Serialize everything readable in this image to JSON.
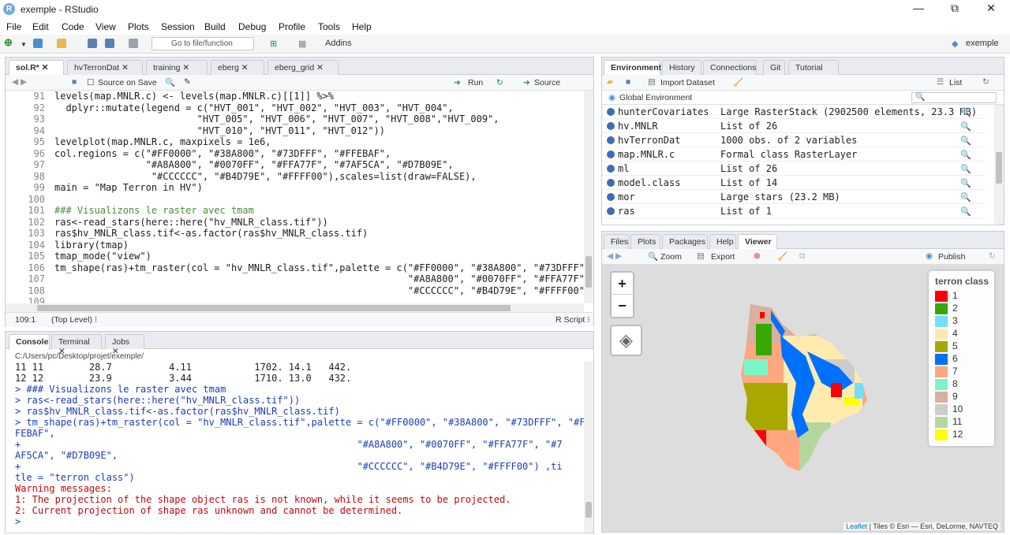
{
  "window": {
    "title": "exemple - RStudio",
    "logo": "R",
    "minimize": "—",
    "restore": "⧉",
    "close": "✕"
  },
  "menu": [
    "File",
    "Edit",
    "Code",
    "View",
    "Plots",
    "Session",
    "Build",
    "Debug",
    "Profile",
    "Tools",
    "Help"
  ],
  "toolbar": {
    "goto_placeholder": "Go to file/function",
    "addins": "Addins",
    "project": "exemple"
  },
  "editor": {
    "tabs": [
      "sol.R*",
      "hvTerronDat",
      "training",
      "eberg",
      "eberg_grid"
    ],
    "source_on_save": "Source on Save",
    "run": "Run",
    "source": "Source",
    "lines": [
      {
        "n": "91",
        "t": "levels(map.MNLR.c) <- levels(map.MNLR.c)[[1]] %>%"
      },
      {
        "n": "92",
        "t": "  dplyr::mutate(legend = c(\"HVT_001\", \"HVT_002\", \"HVT_003\", \"HVT_004\","
      },
      {
        "n": "93",
        "t": "                         \"HVT_005\", \"HVT_006\", \"HVT_007\", \"HVT_008\",\"HVT_009\","
      },
      {
        "n": "94",
        "t": "                         \"HVT_010\", \"HVT_011\", \"HVT_012\"))"
      },
      {
        "n": "95",
        "t": "levelplot(map.MNLR.c, maxpixels = 1e6,"
      },
      {
        "n": "96",
        "t": "col.regions = c(\"#FF0000\", \"#38A800\", \"#73DFFF\", \"#FFEBAF\","
      },
      {
        "n": "97",
        "t": "                \"#A8A800\", \"#0070FF\", \"#FFA77F\", \"#7AF5CA\", \"#D7B09E\","
      },
      {
        "n": "98",
        "t": "                 \"#CCCCCC\", \"#B4D79E\", \"#FFFF00\"),scales=list(draw=FALSE),"
      },
      {
        "n": "99",
        "t": "main = \"Map Terron in HV\")"
      },
      {
        "n": "100",
        "t": ""
      },
      {
        "n": "101",
        "t": "### Visualizons le raster avec tmam"
      },
      {
        "n": "102",
        "t": "ras<-read_stars(here::here(\"hv_MNLR_class.tif\"))"
      },
      {
        "n": "103",
        "t": "ras$hv_MNLR_class.tif<-as.factor(ras$hv_MNLR_class.tif)"
      },
      {
        "n": "104",
        "t": "library(tmap)"
      },
      {
        "n": "105",
        "t": "tmap_mode(\"view\")"
      },
      {
        "n": "106",
        "t": "tm_shape(ras)+tm_raster(col = \"hv_MNLR_class.tif\",palette = c(\"#FF0000\", \"#38A800\", \"#73DFFF\""
      },
      {
        "n": "107",
        "t": "                                                              \"#A8A800\", \"#0070FF\", \"#FFA77F\""
      },
      {
        "n": "108",
        "t": "                                                              \"#CCCCCC\", \"#B4D79E\", \"#FFFF00\""
      },
      {
        "n": "109",
        "t": ""
      }
    ],
    "status_pos": "109:1",
    "status_scope": "(Top Level) ⁝",
    "status_type": "R Script ⁝"
  },
  "console": {
    "tabs": [
      "Console",
      "Terminal",
      "Jobs"
    ],
    "path": "C:/Users/pc/Desktop/projet/exemple/",
    "lines": [
      {
        "t": "11 11        28.7          4.11           1702. 14.1   442.",
        "c": "out"
      },
      {
        "t": "12 12        23.9          3.44           1710. 13.0   432.",
        "c": "out"
      },
      {
        "t": "> ### Visualizons le raster avec tmam",
        "c": "in"
      },
      {
        "t": "> ras<-read_stars(here::here(\"hv_MNLR_class.tif\"))",
        "c": "in"
      },
      {
        "t": "> ras$hv_MNLR_class.tif<-as.factor(ras$hv_MNLR_class.tif)",
        "c": "in"
      },
      {
        "t": "> tm_shape(ras)+tm_raster(col = \"hv_MNLR_class.tif\",palette = c(\"#FF0000\", \"#38A800\", \"#73DFFF\", \"#F",
        "c": "in"
      },
      {
        "t": "FEBAF\",",
        "c": "in"
      },
      {
        "t": "+                                                           \"#A8A800\", \"#0070FF\", \"#FFA77F\", \"#7",
        "c": "in"
      },
      {
        "t": "AF5CA\", \"#D7B09E\",",
        "c": "in"
      },
      {
        "t": "+                                                           \"#CCCCCC\", \"#B4D79E\", \"#FFFF00\") ,ti",
        "c": "in"
      },
      {
        "t": "tle = \"terron class\")",
        "c": "in"
      },
      {
        "t": "Warning messages:",
        "c": "warn"
      },
      {
        "t": "1: The projection of the shape object ras is not known, while it seems to be projected.",
        "c": "warn"
      },
      {
        "t": "2: Current projection of shape ras unknown and cannot be determined.",
        "c": "warn"
      },
      {
        "t": "> ",
        "c": "in"
      }
    ]
  },
  "environment": {
    "tabs": [
      "Environment",
      "History",
      "Connections",
      "Git",
      "Tutorial"
    ],
    "import_dataset": "Import Dataset",
    "list_view": "List",
    "scope": "Global Environment",
    "rows": [
      {
        "name": "hunterCovariates",
        "value": "Large RasterStack (2902500 elements, 23.3 MB)"
      },
      {
        "name": "hv.MNLR",
        "value": "List of 26"
      },
      {
        "name": "hvTerronDat",
        "value": "1000 obs. of 2 variables"
      },
      {
        "name": "map.MNLR.c",
        "value": "Formal class RasterLayer"
      },
      {
        "name": "ml",
        "value": "List of 26"
      },
      {
        "name": "model.class",
        "value": "List of 14"
      },
      {
        "name": "mor",
        "value": "Large stars (23.2 MB)"
      },
      {
        "name": "ras",
        "value": "List of 1"
      }
    ]
  },
  "viewer": {
    "tabs": [
      "Files",
      "Plots",
      "Packages",
      "Help",
      "Viewer"
    ],
    "zoom": "Zoom",
    "export": "Export",
    "publish": "Publish",
    "zoom_in": "+",
    "zoom_out": "−",
    "legend_title": "terron class",
    "legend": [
      {
        "label": "1",
        "color": "#FF0000"
      },
      {
        "label": "2",
        "color": "#38A800"
      },
      {
        "label": "3",
        "color": "#73DFFF"
      },
      {
        "label": "4",
        "color": "#FFEBAF"
      },
      {
        "label": "5",
        "color": "#A8A800"
      },
      {
        "label": "6",
        "color": "#0070FF"
      },
      {
        "label": "7",
        "color": "#FFA77F"
      },
      {
        "label": "8",
        "color": "#7AF5CA"
      },
      {
        "label": "9",
        "color": "#D7B09E"
      },
      {
        "label": "10",
        "color": "#CCCCCC"
      },
      {
        "label": "11",
        "color": "#B4D79E"
      },
      {
        "label": "12",
        "color": "#FFFF00"
      }
    ],
    "attribution_link": "Leaflet",
    "attribution": " | Tiles © Esri — Esri, DeLorme, NAVTEQ"
  }
}
